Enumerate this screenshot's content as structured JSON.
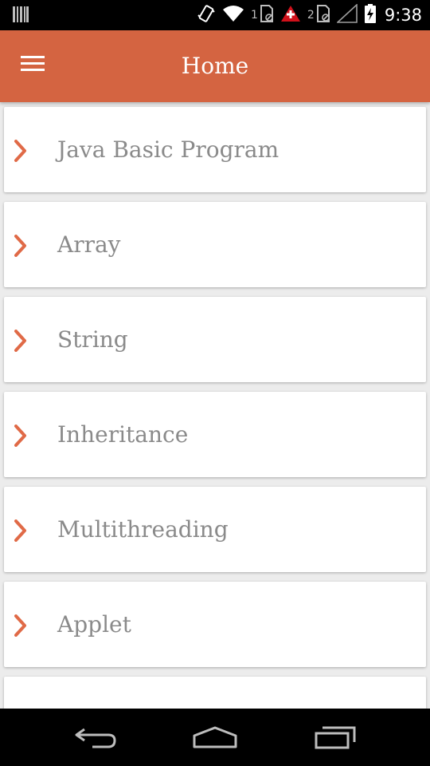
{
  "status_bar": {
    "sim1_label": "1",
    "sim2_label": "2",
    "time": "9:38",
    "icons": [
      "barcode-icon",
      "vibrate-icon",
      "wifi-icon",
      "sim-icon",
      "alert-icon",
      "signal-icon",
      "battery-charging-icon"
    ]
  },
  "app_bar": {
    "title": "Home",
    "menu_icon": "hamburger-menu-icon"
  },
  "colors": {
    "accent": "#d46441",
    "chevron": "#e06a47",
    "item_text": "#8a8a8a",
    "background": "#ececec"
  },
  "list": {
    "items": [
      {
        "label": "Java Basic Program"
      },
      {
        "label": "Array"
      },
      {
        "label": "String"
      },
      {
        "label": "Inheritance"
      },
      {
        "label": "Multithreading"
      },
      {
        "label": "Applet"
      },
      {
        "label": ""
      }
    ]
  },
  "nav_bar": {
    "icons": [
      "back-icon",
      "home-icon",
      "recent-apps-icon"
    ]
  }
}
